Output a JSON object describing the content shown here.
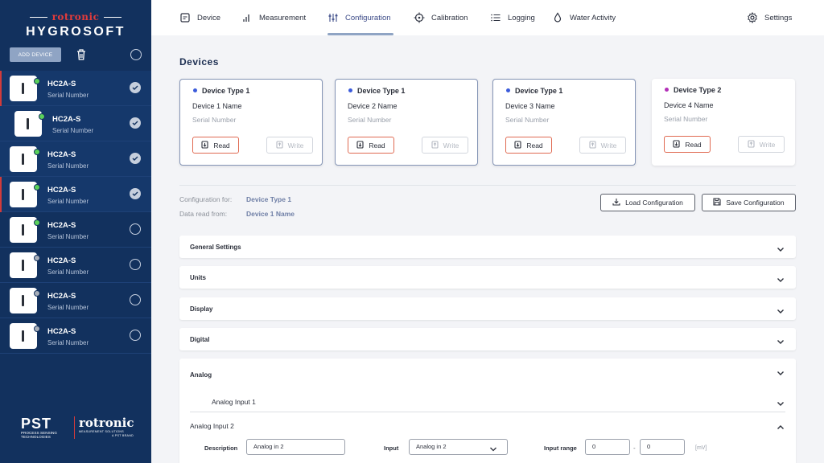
{
  "brand": {
    "top": "rotronic",
    "main": "HYGROSOFT"
  },
  "sidebar": {
    "add_device_label": "ADD DEVICE",
    "devices": [
      {
        "name": "HC2A-S",
        "serial": "Serial Number",
        "status": "green",
        "checked": true
      },
      {
        "name": "HC2A-S",
        "serial": "Serial Number",
        "status": "green",
        "checked": true
      },
      {
        "name": "HC2A-S",
        "serial": "Serial Number",
        "status": "green",
        "checked": true
      },
      {
        "name": "HC2A-S",
        "serial": "Serial Number",
        "status": "green",
        "checked": true
      },
      {
        "name": "HC2A-S",
        "serial": "Serial Number",
        "status": "green",
        "checked": false
      },
      {
        "name": "HC2A-S",
        "serial": "Serial Number",
        "status": "gray",
        "checked": false
      },
      {
        "name": "HC2A-S",
        "serial": "Serial Number",
        "status": "gray",
        "checked": false
      },
      {
        "name": "HC2A-S",
        "serial": "Serial Number",
        "status": "gray",
        "checked": false
      }
    ],
    "footer": {
      "pst": "PST",
      "pst_sub1": "PROCESS SENSING",
      "pst_sub2": "TECHNOLOGIES",
      "rot": "rotronic",
      "rot_sub1": "MEASUREMENT SOLUTIONS",
      "rot_sub2": "A PST BRAND"
    }
  },
  "nav": {
    "items": [
      {
        "label": "Device",
        "icon": "device-icon"
      },
      {
        "label": "Measurement",
        "icon": "measurement-icon"
      },
      {
        "label": "Configuration",
        "icon": "configuration-icon",
        "active": true
      },
      {
        "label": "Calibration",
        "icon": "calibration-icon"
      },
      {
        "label": "Logging",
        "icon": "logging-icon"
      },
      {
        "label": "Water Activity",
        "icon": "water-drop-icon"
      }
    ],
    "settings_label": "Settings"
  },
  "devices_section": {
    "title": "Devices",
    "cards": [
      {
        "type": "Device Type 1",
        "name": "Device 1 Name",
        "serial": "Serial Number",
        "read": "Read",
        "write": "Write",
        "dot_color": "#3b5bdb"
      },
      {
        "type": "Device Type 1",
        "name": "Device 2 Name",
        "serial": "Serial Number",
        "read": "Read",
        "write": "Write",
        "dot_color": "#3b5bdb"
      },
      {
        "type": "Device Type 1",
        "name": "Device 3 Name",
        "serial": "Serial Number",
        "read": "Read",
        "write": "Write",
        "dot_color": "#3b5bdb"
      },
      {
        "type": "Device Type 2",
        "name": "Device 4 Name",
        "serial": "Serial Number",
        "read": "Read",
        "write": "Write",
        "dot_color": "#b32fb8"
      }
    ]
  },
  "config": {
    "for_label": "Configuration for:",
    "for_value": "Device Type 1",
    "read_label": "Data read from:",
    "read_value": "Device 1 Name",
    "load_label": "Load Configuration",
    "save_label": "Save Configuration"
  },
  "accordions": [
    "General Settings",
    "Units",
    "Display",
    "Digital"
  ],
  "analog": {
    "title": "Analog",
    "input1_title": "Analog Input 1",
    "input2_title": "Analog Input 2",
    "description_label": "Description",
    "description_value": "Analog in 2",
    "input_label": "Input",
    "input_value": "Analog in 2",
    "range_label": "Input range",
    "range_min": "0",
    "range_sep": "-",
    "range_max": "0",
    "range_unit": "[mV]"
  },
  "colors": {
    "sidebar": "#12315e",
    "accent": "#3b4a87",
    "read_border": "#e06a52",
    "status_green": "#5ad15a"
  }
}
